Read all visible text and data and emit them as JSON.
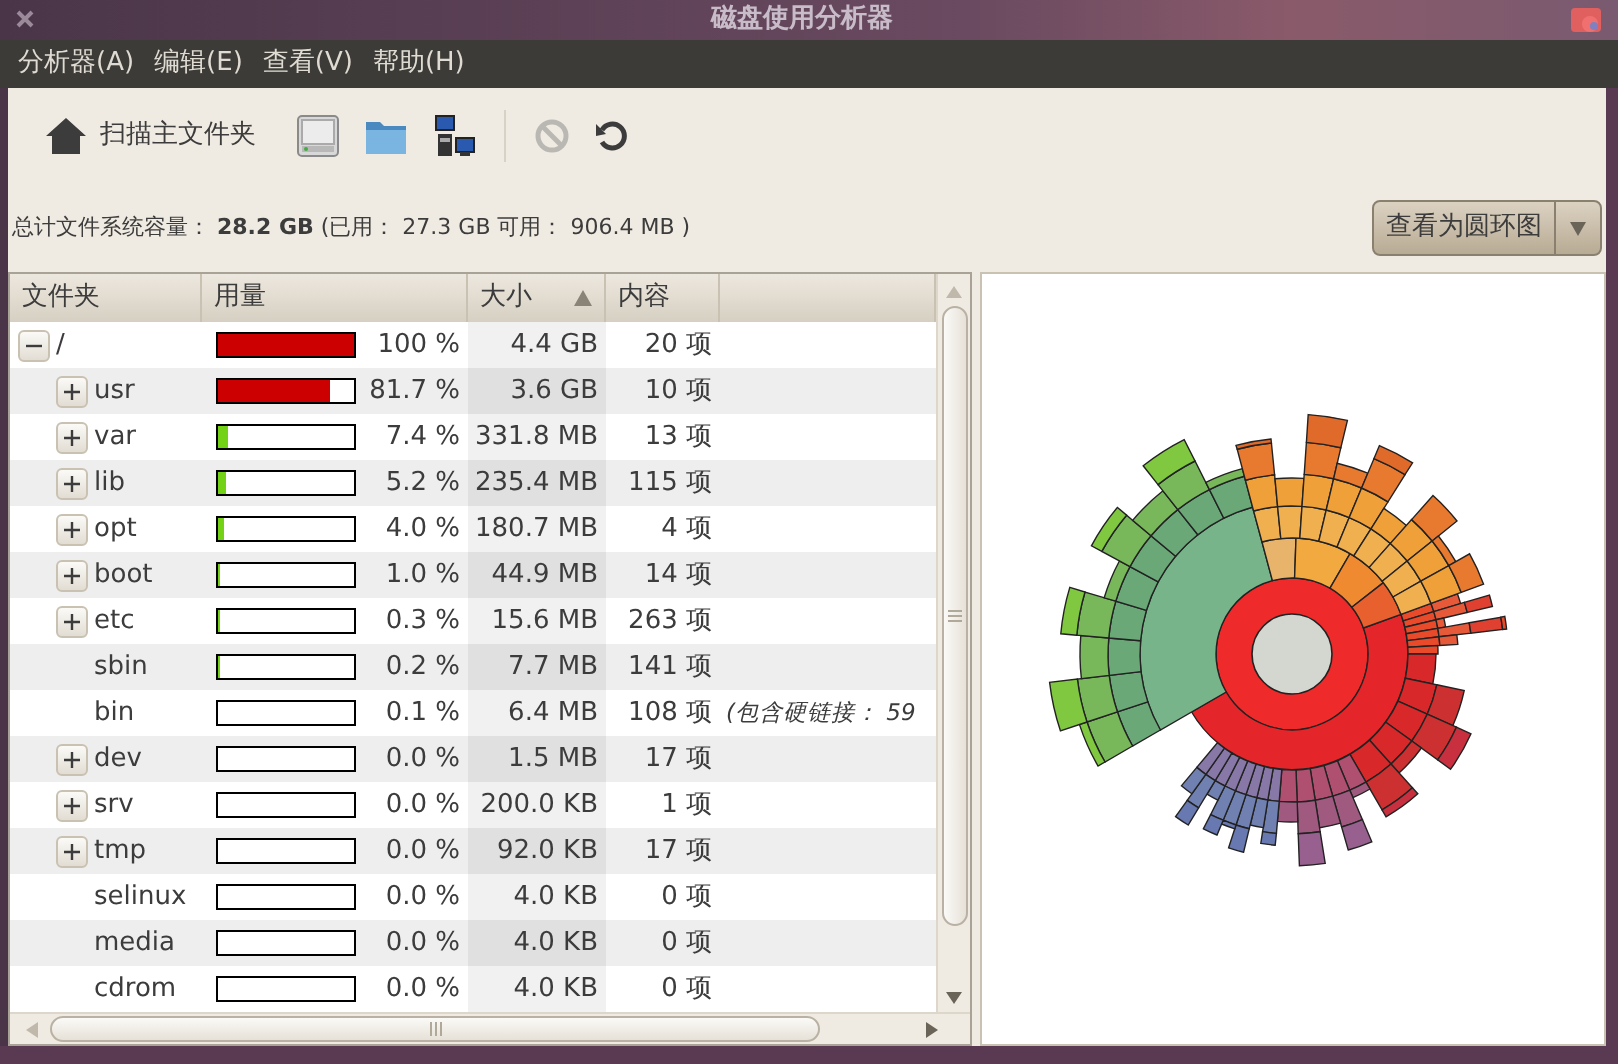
{
  "window": {
    "title": "磁盘使用分析器"
  },
  "menu": [
    {
      "label": "分析器(A)"
    },
    {
      "label": "编辑(E)"
    },
    {
      "label": "查看(V)"
    },
    {
      "label": "帮助(H)"
    }
  ],
  "toolbar": [
    {
      "kind": "scan-home",
      "label": "扫描主文件夹",
      "disabled": false
    },
    {
      "kind": "scan-disk",
      "disabled": false
    },
    {
      "kind": "scan-folder",
      "disabled": false
    },
    {
      "kind": "scan-remote",
      "disabled": false
    },
    {
      "kind": "stop",
      "disabled": true
    },
    {
      "kind": "refresh",
      "disabled": false
    }
  ],
  "summary": "总计文件系统容量： **28.2 GB** (已用： 27.3 GB 可用： 906.4 MB )",
  "view_button": {
    "label": "查看为圆环图"
  },
  "columns": [
    {
      "label": "文件夹",
      "sorted": false
    },
    {
      "label": "用量",
      "sorted": false
    },
    {
      "label": "大小",
      "sorted": true
    },
    {
      "label": "内容",
      "sorted": false
    }
  ],
  "tree": [
    {
      "kind": "folder",
      "name": "/",
      "expanded": true,
      "level": 1,
      "percent": "100 %",
      "size": "4.4 GB",
      "contents": "20 项",
      "children": [
        {
          "kind": "folder",
          "name": "usr",
          "expanded": false,
          "level": 0.817,
          "percent": "81.7 %",
          "size": "3.6 GB",
          "contents": "10 项"
        },
        {
          "kind": "folder",
          "name": "var",
          "expanded": false,
          "level": 0.074,
          "percent": "7.4 %",
          "size": "331.8 MB",
          "contents": "13 项"
        },
        {
          "kind": "folder",
          "name": "lib",
          "expanded": false,
          "level": 0.052,
          "percent": "5.2 %",
          "size": "235.4 MB",
          "contents": "115 项"
        },
        {
          "kind": "folder",
          "name": "opt",
          "expanded": false,
          "level": 0.04,
          "percent": "4.0 %",
          "size": "180.7 MB",
          "contents": "4 项"
        },
        {
          "kind": "folder",
          "name": "boot",
          "expanded": false,
          "level": 0.01,
          "percent": "1.0 %",
          "size": "44.9 MB",
          "contents": "14 项"
        },
        {
          "kind": "folder",
          "name": "etc",
          "expanded": false,
          "level": 0.003,
          "percent": "0.3 %",
          "size": "15.6 MB",
          "contents": "263 项"
        },
        {
          "kind": "leaf",
          "name": "sbin",
          "level": 0.002,
          "percent": "0.2 %",
          "size": "7.7 MB",
          "contents": "141 项"
        },
        {
          "kind": "leaf",
          "name": "bin",
          "level": 0.001,
          "percent": "0.1 %",
          "size": "6.4 MB",
          "contents": "108 项",
          "note": "(包含硬链接： 59"
        },
        {
          "kind": "folder",
          "name": "dev",
          "expanded": false,
          "level": 0,
          "percent": "0.0 %",
          "size": "1.5 MB",
          "contents": "17 项"
        },
        {
          "kind": "folder",
          "name": "srv",
          "expanded": false,
          "level": 0,
          "percent": "0.0 %",
          "size": "200.0 KB",
          "contents": "1 项"
        },
        {
          "kind": "folder",
          "name": "tmp",
          "expanded": false,
          "level": 0,
          "percent": "0.0 %",
          "size": "92.0 KB",
          "contents": "17 项"
        },
        {
          "kind": "leaf",
          "name": "selinux",
          "level": 0,
          "percent": "0.0 %",
          "size": "4.0 KB",
          "contents": "0 项"
        },
        {
          "kind": "leaf",
          "name": "media",
          "level": 0,
          "percent": "0.0 %",
          "size": "4.0 KB",
          "contents": "0 项"
        },
        {
          "kind": "leaf",
          "name": "cdrom",
          "level": 0,
          "percent": "0.0 %",
          "size": "4.0 KB",
          "contents": "0 项"
        }
      ]
    }
  ]
}
